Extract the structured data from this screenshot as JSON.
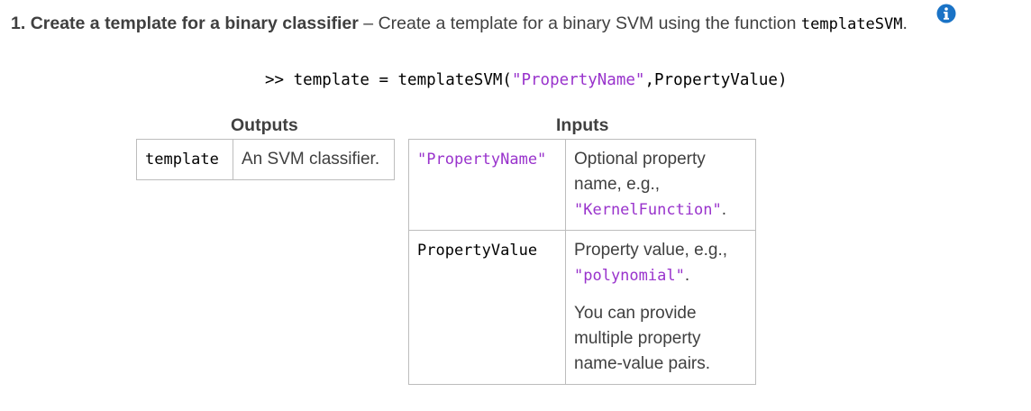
{
  "step": {
    "number": "1.",
    "title": "Create a template for a binary classifier",
    "dash": "–",
    "text": "Create a template for a binary SVM using the function",
    "function": "templateSVM",
    "period": "."
  },
  "info_icon": "info-icon",
  "code": {
    "prompt": ">>",
    "lhs": "template = templateSVM(",
    "arg_string": "\"PropertyName\"",
    "rest": ",PropertyValue)"
  },
  "outputs": {
    "caption": "Outputs",
    "rows": [
      {
        "name": "template",
        "description": "An SVM classifier."
      }
    ]
  },
  "inputs": {
    "caption": "Inputs",
    "rows": [
      {
        "name": "\"PropertyName\"",
        "description": "Optional property name, e.g.,",
        "example": "\"KernelFunction\"",
        "example_suffix": "."
      },
      {
        "name": "PropertyValue",
        "description": "Property value, e.g.,",
        "example": "\"polynomial\"",
        "example_suffix": ".",
        "note": "You can provide multiple property name-value pairs."
      }
    ]
  },
  "colors": {
    "string_literal": "#9933cc",
    "text": "#404040",
    "border": "#bdbdbd",
    "info_icon": "#1a73c6"
  }
}
